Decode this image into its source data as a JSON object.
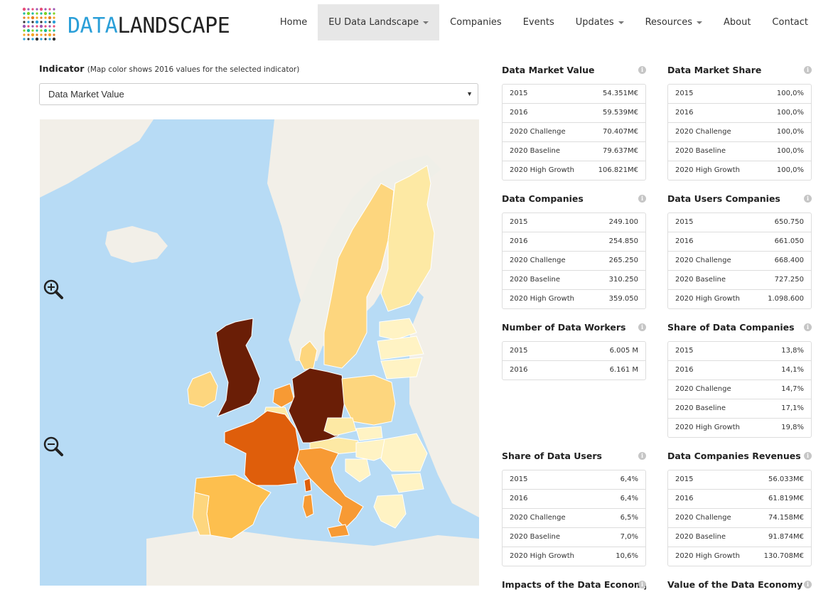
{
  "brand": {
    "part1": "DATA",
    "part2": "LANDSCAPE"
  },
  "nav": [
    {
      "label": "Home"
    },
    {
      "label": "EU Data Landscape",
      "dropdown": true,
      "active": true
    },
    {
      "label": "Companies"
    },
    {
      "label": "Events"
    },
    {
      "label": "Updates",
      "dropdown": true
    },
    {
      "label": "Resources",
      "dropdown": true
    },
    {
      "label": "About"
    },
    {
      "label": "Contact"
    }
  ],
  "indicator": {
    "label": "Indicator",
    "note": "(Map color shows 2016 values for the selected indicator)",
    "selected": "Data Market Value"
  },
  "map": {
    "colors": {
      "sea": "#b7dbf5",
      "land": "#f2efe8",
      "darkest": "#6a1e06",
      "high": "#df5e0b",
      "upper": "#f79a34",
      "mid": "#fdbf4e",
      "light": "#fdd67e",
      "pale": "#fde9a4",
      "palest": "#fff3c4"
    }
  },
  "panels": [
    {
      "title": "Data Market Value",
      "rows": [
        [
          "2015",
          "54.351M€"
        ],
        [
          "2016",
          "59.539M€"
        ],
        [
          "2020 Challenge",
          "70.407M€"
        ],
        [
          "2020 Baseline",
          "79.637M€"
        ],
        [
          "2020 High Growth",
          "106.821M€"
        ]
      ]
    },
    {
      "title": "Data Market Share",
      "rows": [
        [
          "2015",
          "100,0%"
        ],
        [
          "2016",
          "100,0%"
        ],
        [
          "2020 Challenge",
          "100,0%"
        ],
        [
          "2020 Baseline",
          "100,0%"
        ],
        [
          "2020 High Growth",
          "100,0%"
        ]
      ]
    },
    {
      "title": "Data Companies",
      "rows": [
        [
          "2015",
          "249.100"
        ],
        [
          "2016",
          "254.850"
        ],
        [
          "2020 Challenge",
          "265.250"
        ],
        [
          "2020 Baseline",
          "310.250"
        ],
        [
          "2020 High Growth",
          "359.050"
        ]
      ]
    },
    {
      "title": "Data Users Companies",
      "rows": [
        [
          "2015",
          "650.750"
        ],
        [
          "2016",
          "661.050"
        ],
        [
          "2020 Challenge",
          "668.400"
        ],
        [
          "2020 Baseline",
          "727.250"
        ],
        [
          "2020 High Growth",
          "1.098.600"
        ]
      ]
    },
    {
      "title": "Number of Data Workers",
      "rows": [
        [
          "2015",
          "6.005 M"
        ],
        [
          "2016",
          "6.161 M"
        ]
      ]
    },
    {
      "title": "Share of Data Companies",
      "rows": [
        [
          "2015",
          "13,8%"
        ],
        [
          "2016",
          "14,1%"
        ],
        [
          "2020 Challenge",
          "14,7%"
        ],
        [
          "2020 Baseline",
          "17,1%"
        ],
        [
          "2020 High Growth",
          "19,8%"
        ]
      ]
    },
    {
      "title": "Share of Data Users",
      "rows": [
        [
          "2015",
          "6,4%"
        ],
        [
          "2016",
          "6,4%"
        ],
        [
          "2020 Challenge",
          "6,5%"
        ],
        [
          "2020 Baseline",
          "7,0%"
        ],
        [
          "2020 High Growth",
          "10,6%"
        ]
      ]
    },
    {
      "title": "Data Companies Revenues",
      "rows": [
        [
          "2015",
          "56.033M€"
        ],
        [
          "2016",
          "61.819M€"
        ],
        [
          "2020 Challenge",
          "74.158M€"
        ],
        [
          "2020 Baseline",
          "91.874M€"
        ],
        [
          "2020 High Growth",
          "130.708M€"
        ]
      ]
    },
    {
      "title": "Impacts of the Data Economy",
      "rows": []
    },
    {
      "title": "Value of the Data Economy",
      "rows": []
    }
  ]
}
